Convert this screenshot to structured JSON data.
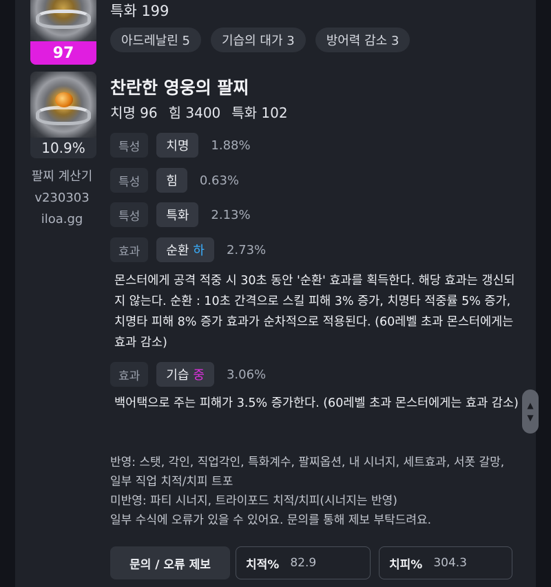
{
  "prev_item": {
    "badge": "97",
    "stat": "특화 199",
    "engravings": [
      "아드레날린 5",
      "기습의 대가 3",
      "방어력 감소 3"
    ]
  },
  "item": {
    "name": "찬란한 영웅의 팔찌",
    "badge": "10.9%",
    "stats": [
      "치명 96",
      "힘 3400",
      "특화 102"
    ],
    "options": [
      {
        "kind": "특성",
        "name": "치명",
        "grade": "",
        "pct": "1.88%"
      },
      {
        "kind": "특성",
        "name": "힘",
        "grade": "",
        "pct": "0.63%"
      },
      {
        "kind": "특성",
        "name": "특화",
        "grade": "",
        "pct": "2.13%"
      },
      {
        "kind": "효과",
        "name": "순환",
        "grade": "하",
        "pct": "2.73%",
        "desc": "몬스터에게 공격 적중 시 30초 동안 '순환' 효과를 획득한다. 해당 효과는 갱신되지 않는다. 순환 : 10초 간격으로 스킬 피해 3% 증가, 치명타 적중률 5% 증가, 치명타 피해 8% 증가 효과가 순차적으로 적용된다. (60레벨 초과 몬스터에게는 효과 감소)"
      },
      {
        "kind": "효과",
        "name": "기습",
        "grade": "중",
        "pct": "3.06%",
        "desc": "백어택으로 주는 피해가 3.5% 증가한다. (60레벨 초과 몬스터에게는 효과 감소)"
      }
    ]
  },
  "sidebar": {
    "title": "팔찌 계산기",
    "version": "v230303",
    "site": "iloa.gg"
  },
  "notes": {
    "reflected": "반영: 스탯, 각인, 직업각인, 특화계수, 팔찌옵션, 내 시너지, 세트효과, 서폿 갈망, 일부 직업 치적/치피 트포",
    "unreflected": "미반영: 파티 시너지, 트라이포드 치적/치피(시너지는 반영)",
    "disclaimer": "일부 수식에 오류가 있을 수 있어요. 문의를 통해 제보 부탁드려요."
  },
  "footer": {
    "report_button": "문의 / 오류 제보",
    "crit_rate_label": "치적%",
    "crit_rate_value": "82.9",
    "crit_dmg_label": "치피%",
    "crit_dmg_value": "304.3"
  },
  "colors": {
    "badge_prev": "#e01ee0",
    "grade_low": "#3ab0ff",
    "grade_mid": "#e030e0"
  },
  "icons": {
    "scroll": [
      "chevron-up-icon",
      "chevron-down-icon"
    ]
  }
}
